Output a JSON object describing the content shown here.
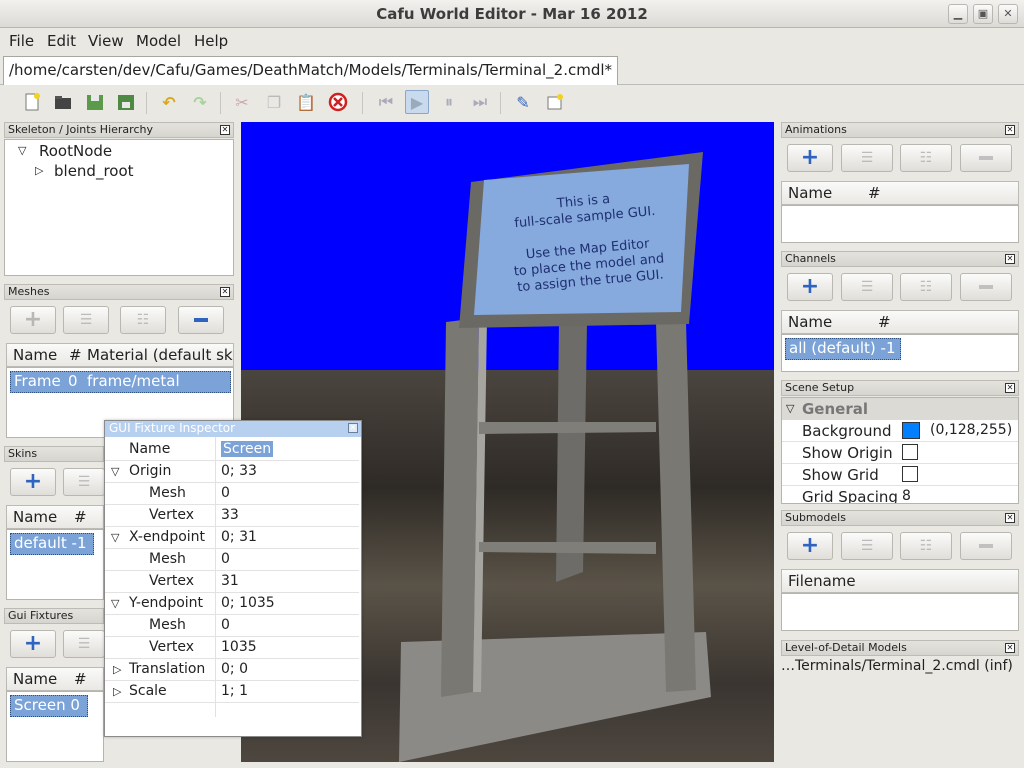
{
  "window": {
    "title": "Cafu World Editor - Mar 16 2012"
  },
  "menu": [
    "File",
    "Edit",
    "View",
    "Model",
    "Help"
  ],
  "document_tab": "/home/carsten/dev/Cafu/Games/DeathMatch/Models/Terminals/Terminal_2.cmdl*",
  "skeleton": {
    "title": "Skeleton / Joints Hierarchy",
    "root": "RootNode",
    "child": "blend_root"
  },
  "meshes": {
    "title": "Meshes",
    "columns": [
      "Name",
      "#",
      "Material (default skin"
    ],
    "row": {
      "name": "Frame",
      "num": "0",
      "material": "frame/metal"
    }
  },
  "skins": {
    "title": "Skins",
    "columns": [
      "Name",
      "#"
    ],
    "row": "default  -1"
  },
  "gui_fixtures": {
    "title": "Gui Fixtures",
    "columns": [
      "Name",
      "#"
    ],
    "row": "Screen  0"
  },
  "inspector": {
    "title": "GUI Fixture Inspector",
    "rows": [
      {
        "label": "Name",
        "value": "Screen"
      },
      {
        "label": "Origin",
        "value": "0; 33"
      },
      {
        "label": "Mesh",
        "value": "0"
      },
      {
        "label": "Vertex",
        "value": "33"
      },
      {
        "label": "X-endpoint",
        "value": "0; 31"
      },
      {
        "label": "Mesh",
        "value": "0"
      },
      {
        "label": "Vertex",
        "value": "31"
      },
      {
        "label": "Y-endpoint",
        "value": "0; 1035"
      },
      {
        "label": "Mesh",
        "value": "0"
      },
      {
        "label": "Vertex",
        "value": "1035"
      },
      {
        "label": "Translation",
        "value": "0; 0"
      },
      {
        "label": "Scale",
        "value": "1; 1"
      }
    ]
  },
  "viewport": {
    "gui_text": [
      "This is a",
      "full-scale sample GUI.",
      "",
      "Use the Map Editor",
      "to place the model and",
      "to assign the true GUI."
    ],
    "sky_color": "#0000ff"
  },
  "animations": {
    "title": "Animations",
    "columns": [
      "Name",
      "#"
    ]
  },
  "channels": {
    "title": "Channels",
    "columns": [
      "Name",
      "#"
    ],
    "row": "all (default)  -1"
  },
  "scene_setup": {
    "title": "Scene Setup",
    "group": "General",
    "background_label": "Background C",
    "background_value": "(0,128,255)",
    "background_color": "#0080ff",
    "show_origin": "Show Origin",
    "show_grid": "Show Grid",
    "grid_spacing": "Grid Spacing",
    "grid_spacing_value": "8"
  },
  "submodels": {
    "title": "Submodels",
    "columns": [
      "Filename"
    ]
  },
  "lod": {
    "title": "Level-of-Detail Models",
    "row": "…Terminals/Terminal_2.cmdl (inf)"
  }
}
